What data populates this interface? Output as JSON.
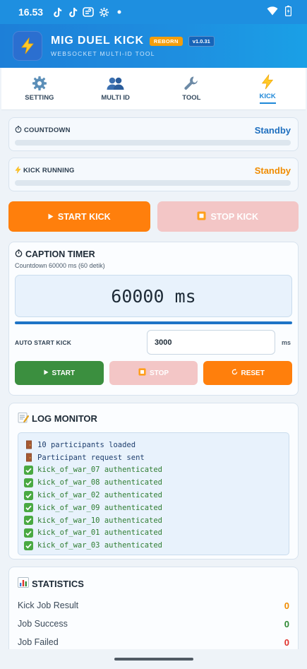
{
  "statusbar": {
    "time": "16.53",
    "icons": [
      "tiktok-icon",
      "tiktok-icon",
      "wind-icon",
      "gear-icon",
      "dot-icon",
      "wifi-icon",
      "battery-icon"
    ]
  },
  "app": {
    "title": "MIG DUEL KICK",
    "badge": "REBORN",
    "version": "v1.0.31",
    "subtitle": "WEBSOCKET MULTI-ID TOOL",
    "icon": "lightning-icon"
  },
  "tabs": [
    {
      "label": "SETTING",
      "icon": "gear-icon",
      "active": false
    },
    {
      "label": "MULTI ID",
      "icon": "users-icon",
      "active": false
    },
    {
      "label": "TOOL",
      "icon": "wrench-icon",
      "active": false
    },
    {
      "label": "KICK",
      "icon": "lightning-icon",
      "active": true
    }
  ],
  "countdown": {
    "label": "COUNTDOWN",
    "status": "Standby",
    "color": "#1e6fbf",
    "progress": 0
  },
  "kick_running": {
    "label": "KICK RUNNING",
    "status": "Standby",
    "color": "#f08c00",
    "progress": 0
  },
  "main_buttons": {
    "start": "START KICK",
    "stop": "STOP KICK"
  },
  "caption_timer": {
    "title": "CAPTION TIMER",
    "subtitle": "Countdown 60000 ms (60 detik)",
    "display": "60000 ms",
    "progress": 1.0,
    "auto_label": "AUTO START KICK",
    "auto_value": "3000",
    "auto_unit": "ms",
    "buttons": {
      "start": "START",
      "stop": "STOP",
      "reset": "RESET"
    }
  },
  "log": {
    "title": "LOG MONITOR",
    "lines": [
      {
        "icon": "door-icon",
        "type": "info",
        "text": "10 participants loaded"
      },
      {
        "icon": "door-icon",
        "type": "info",
        "text": "Participant request sent"
      },
      {
        "icon": "check-icon",
        "type": "ok",
        "text": "kick_of_war_07 authenticated"
      },
      {
        "icon": "check-icon",
        "type": "ok",
        "text": "kick_of_war_08 authenticated"
      },
      {
        "icon": "check-icon",
        "type": "ok",
        "text": "kick_of_war_02 authenticated"
      },
      {
        "icon": "check-icon",
        "type": "ok",
        "text": "kick_of_war_09 authenticated"
      },
      {
        "icon": "check-icon",
        "type": "ok",
        "text": "kick_of_war_10 authenticated"
      },
      {
        "icon": "check-icon",
        "type": "ok",
        "text": "kick_of_war_01 authenticated"
      },
      {
        "icon": "check-icon",
        "type": "ok",
        "text": "kick_of_war_03 authenticated"
      }
    ]
  },
  "statistics": {
    "title": "STATISTICS",
    "rows": [
      {
        "label": "Kick Job Result",
        "value": "0",
        "color": "#f08c00"
      },
      {
        "label": "Job Success",
        "value": "0",
        "color": "#2f8a35"
      },
      {
        "label": "Job Failed",
        "value": "0",
        "color": "#e0322c"
      }
    ]
  }
}
